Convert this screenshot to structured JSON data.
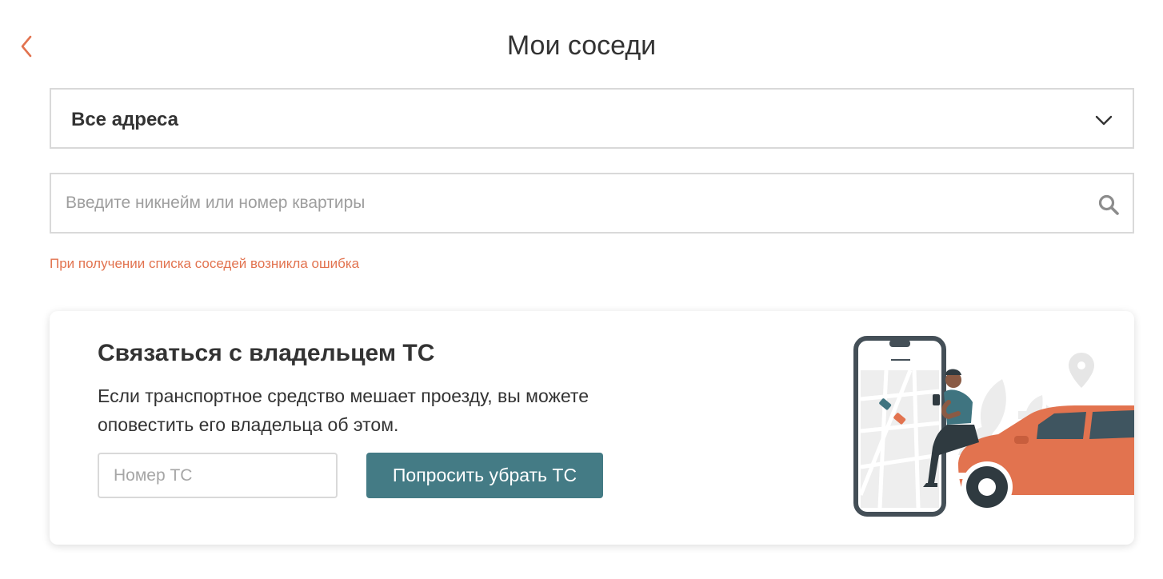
{
  "header": {
    "back_icon": "chevron-left-icon",
    "title": "Мои соседи"
  },
  "address_select": {
    "selected": "Все адреса",
    "icon": "chevron-down-icon"
  },
  "search": {
    "placeholder": "Введите никнейм или номер квартиры",
    "value": "",
    "icon": "search-icon"
  },
  "error": {
    "message": "При получении списка соседей возникла ошибка"
  },
  "vehicle_card": {
    "title": "Связаться с владельцем ТС",
    "description": "Если транспортное средство мешает проезду, вы можете оповестить его владельца об этом.",
    "plate_placeholder": "Номер ТС",
    "plate_value": "",
    "button_label": "Попросить убрать ТС",
    "illustration": "person-with-phone-and-car-illustration"
  },
  "colors": {
    "accent": "#e2734f",
    "button": "#447b85",
    "border": "#d9d9d9",
    "text": "#333333"
  }
}
